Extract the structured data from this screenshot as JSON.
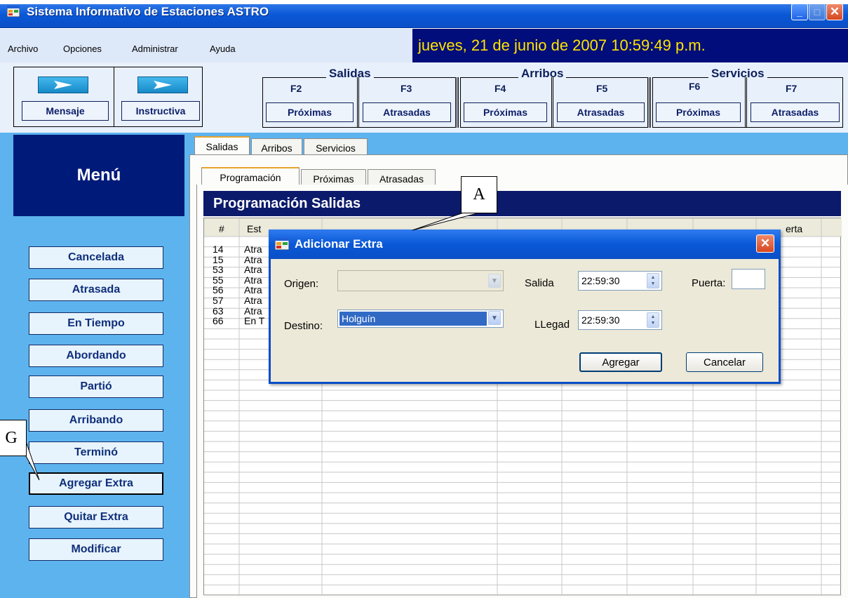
{
  "window": {
    "title": "Sistema Informativo de Estaciones ASTRO",
    "min_glyph": "_",
    "max_glyph": "□",
    "close_glyph": "✕"
  },
  "menubar": {
    "items": [
      "Archivo",
      "Opciones",
      "Administrar",
      "Ayuda"
    ],
    "datetime": "jueves, 21 de junio de 2007 10:59:49 p.m."
  },
  "toolbar": {
    "quick_buttons": [
      "Mensaje",
      "Instructiva"
    ],
    "groups": [
      {
        "title": "Salidas",
        "keys": [
          {
            "fkey": "F2",
            "label": "Próximas"
          },
          {
            "fkey": "F3",
            "label": "Atrasadas"
          }
        ]
      },
      {
        "title": "Arribos",
        "keys": [
          {
            "fkey": "F4",
            "label": "Próximas"
          },
          {
            "fkey": "F5",
            "label": "Atrasadas"
          }
        ]
      },
      {
        "title": "Servicios",
        "keys": [
          {
            "fkey": "F6",
            "label": "Próximas"
          },
          {
            "fkey": "F7",
            "label": "Atrasadas"
          }
        ]
      }
    ]
  },
  "sidebar": {
    "title": "Menú",
    "buttons": [
      "Cancelada",
      "Atrasada",
      "En Tiempo",
      "Abordando",
      "Partió",
      "Arribando",
      "Terminó",
      "Agregar Extra",
      "Quitar Extra",
      "Modificar"
    ],
    "active": "Agregar Extra"
  },
  "main": {
    "tabs": [
      "Salidas",
      "Arribos",
      "Servicios"
    ],
    "subtabs": [
      "Programación",
      "Próximas",
      "Atrasadas"
    ],
    "panel_title": "Programación Salidas",
    "grid": {
      "columns": [
        "#",
        "Est",
        "erta"
      ],
      "rows": [
        {
          "num": "14",
          "estado": "Atra"
        },
        {
          "num": "15",
          "estado": "Atra"
        },
        {
          "num": "53",
          "estado": "Atra"
        },
        {
          "num": "55",
          "estado": "Atra"
        },
        {
          "num": "56",
          "estado": "Atra"
        },
        {
          "num": "57",
          "estado": "Atra"
        },
        {
          "num": "63",
          "estado": "Atra"
        },
        {
          "num": "66",
          "estado": "En T"
        }
      ]
    }
  },
  "dialog": {
    "title": "Adicionar Extra",
    "origen_label": "Origen:",
    "origen_value": "",
    "destino_label": "Destino:",
    "destino_value": "Holguín",
    "salida_label": "Salida",
    "salida_value": "22:59:30",
    "llegada_label": "LLegad",
    "llegada_value": "22:59:30",
    "puerta_label": "Puerta:",
    "puerta_value": "",
    "agregar_label": "Agregar",
    "cancelar_label": "Cancelar"
  },
  "callouts": {
    "a": "A",
    "g": "G"
  }
}
